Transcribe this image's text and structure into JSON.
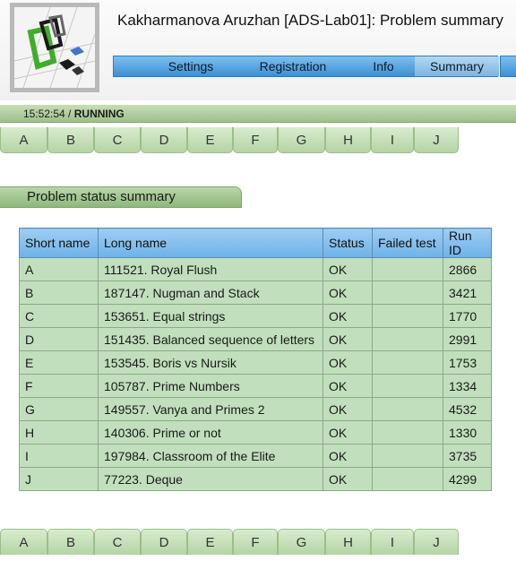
{
  "header": {
    "title": "Kakharmanova Aruzhan [ADS-Lab01]: Problem summary",
    "menu": [
      {
        "label": "Settings"
      },
      {
        "label": "Registration"
      },
      {
        "label": "Info"
      },
      {
        "label": "Summary",
        "active": true
      }
    ]
  },
  "status": {
    "time": "15:52:54",
    "separator": " / ",
    "state": "RUNNING"
  },
  "problem_tabs": [
    "A",
    "B",
    "C",
    "D",
    "E",
    "F",
    "G",
    "H",
    "I",
    "J"
  ],
  "section": {
    "title": "Problem status summary"
  },
  "table": {
    "columns": [
      "Short name",
      "Long name",
      "Status",
      "Failed test",
      "Run ID"
    ],
    "rows": [
      {
        "short": "A",
        "long": "111521. Royal Flush",
        "status": "OK",
        "failed": "",
        "run_id": "2866"
      },
      {
        "short": "B",
        "long": "187147. Nugman and Stack",
        "status": "OK",
        "failed": "",
        "run_id": "3421"
      },
      {
        "short": "C",
        "long": "153651. Equal strings",
        "status": "OK",
        "failed": "",
        "run_id": "1770"
      },
      {
        "short": "D",
        "long": "151435. Balanced sequence of letters",
        "status": "OK",
        "failed": "",
        "run_id": "2991"
      },
      {
        "short": "E",
        "long": "153545. Boris vs Nursik",
        "status": "OK",
        "failed": "",
        "run_id": "1753"
      },
      {
        "short": "F",
        "long": "105787. Prime Numbers",
        "status": "OK",
        "failed": "",
        "run_id": "1334"
      },
      {
        "short": "G",
        "long": "149557. Vanya and Primes 2",
        "status": "OK",
        "failed": "",
        "run_id": "4532"
      },
      {
        "short": "H",
        "long": "140306. Prime or not",
        "status": "OK",
        "failed": "",
        "run_id": "1330"
      },
      {
        "short": "I",
        "long": "197984. Classroom of the Elite",
        "status": "OK",
        "failed": "",
        "run_id": "3735"
      },
      {
        "short": "J",
        "long": "77223. Deque",
        "status": "OK",
        "failed": "",
        "run_id": "4299"
      }
    ]
  },
  "colors": {
    "menu_blue": "#4d9fe0",
    "green_row": "#c1dfbd",
    "header_blue": "#7fbdec"
  }
}
